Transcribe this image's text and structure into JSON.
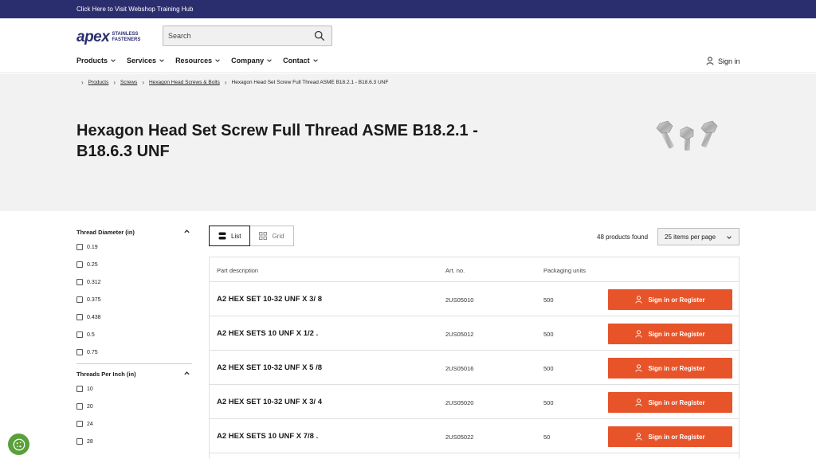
{
  "topbar": {
    "text": "Click Here to Visit Webshop Training Hub"
  },
  "logo": {
    "word": "apex",
    "line1": "STAINLESS",
    "line2": "FASTENERS"
  },
  "search": {
    "placeholder": "Search"
  },
  "nav": {
    "items": [
      {
        "label": "Products"
      },
      {
        "label": "Services"
      },
      {
        "label": "Resources"
      },
      {
        "label": "Company"
      },
      {
        "label": "Contact"
      }
    ]
  },
  "account": {
    "signin_label": "Sign in"
  },
  "breadcrumb": {
    "items": [
      {
        "label": "Products"
      },
      {
        "label": "Screws"
      },
      {
        "label": "Hexagon Head Screws & Bolts"
      },
      {
        "label": "Hexagon Head Set Screw Full Thread ASME B18.2.1 - B18.6.3 UNF"
      }
    ]
  },
  "page": {
    "title": "Hexagon Head Set Screw Full Thread ASME B18.2.1 - B18.6.3 UNF"
  },
  "filters": [
    {
      "title": "Thread Diameter (in)",
      "options": [
        "0.19",
        "0.25",
        "0.312",
        "0.375",
        "0.438",
        "0.5",
        "0.75"
      ]
    },
    {
      "title": "Threads Per Inch (in)",
      "options": [
        "10",
        "20",
        "24",
        "28"
      ]
    }
  ],
  "view_toggle": {
    "list": "List",
    "grid": "Grid"
  },
  "results": {
    "found": "48 products found",
    "per_page": "25 items per page"
  },
  "table": {
    "headers": {
      "desc": "Part description",
      "art": "Art. no.",
      "pack": "Packaging units"
    },
    "button_label": "Sign in or Register",
    "rows": [
      {
        "desc": "A2 HEX SET 10-32 UNF X 3/ 8",
        "art": "2US05010",
        "pack": "500"
      },
      {
        "desc": "A2 HEX SETS 10 UNF X 1/2 .",
        "art": "2US05012",
        "pack": "500"
      },
      {
        "desc": "A2 HEX SET 10-32 UNF X 5 /8",
        "art": "2US05016",
        "pack": "500"
      },
      {
        "desc": "A2 HEX SET 10-32 UNF X 3/ 4",
        "art": "2US05020",
        "pack": "500"
      },
      {
        "desc": "A2 HEX SETS 10 UNF X 7/8 .",
        "art": "2US05022",
        "pack": "50"
      }
    ]
  },
  "colors": {
    "brand": "#2b2e6e",
    "accent": "#e8542a",
    "hero_bg": "#f2f2f2",
    "cookie": "#5aa03a"
  },
  "icons": {
    "search": "search-icon",
    "user": "user-icon",
    "chevron": "chevron-down-icon",
    "list": "list-icon",
    "grid": "grid-icon",
    "cookie": "cookie-icon"
  }
}
